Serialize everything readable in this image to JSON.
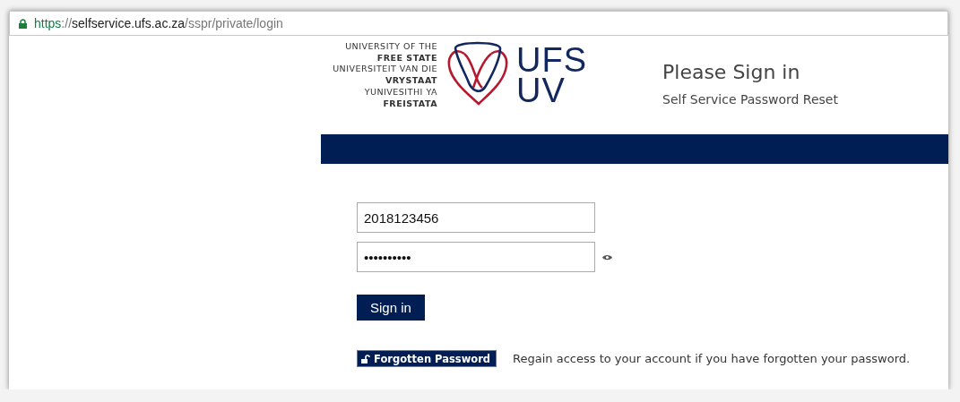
{
  "address_bar": {
    "secure": true,
    "scheme": "https",
    "separator": "://",
    "host": "selfservice.ufs.ac.za",
    "path": "/sspr/private/login"
  },
  "logo": {
    "lines": [
      {
        "text": "UNIVERSITY OF THE",
        "bold": false
      },
      {
        "text": "FREE STATE",
        "bold": true
      },
      {
        "text": "UNIVERSITEIT VAN DIE",
        "bold": false
      },
      {
        "text": "VRYSTAAT",
        "bold": true
      },
      {
        "text": "YUNIVESITHI YA",
        "bold": false
      },
      {
        "text": "FREISTATA",
        "bold": true
      }
    ],
    "mark_lines": [
      "UFS",
      "UV"
    ]
  },
  "header": {
    "title": "Please Sign in",
    "subtitle": "Self Service Password Reset"
  },
  "form": {
    "username": "2018123456",
    "password": "••••••••••",
    "sign_in": "Sign in"
  },
  "forgotten": {
    "button": "Forgotten Password",
    "text": "Regain access to your account if you have forgotten your password."
  }
}
